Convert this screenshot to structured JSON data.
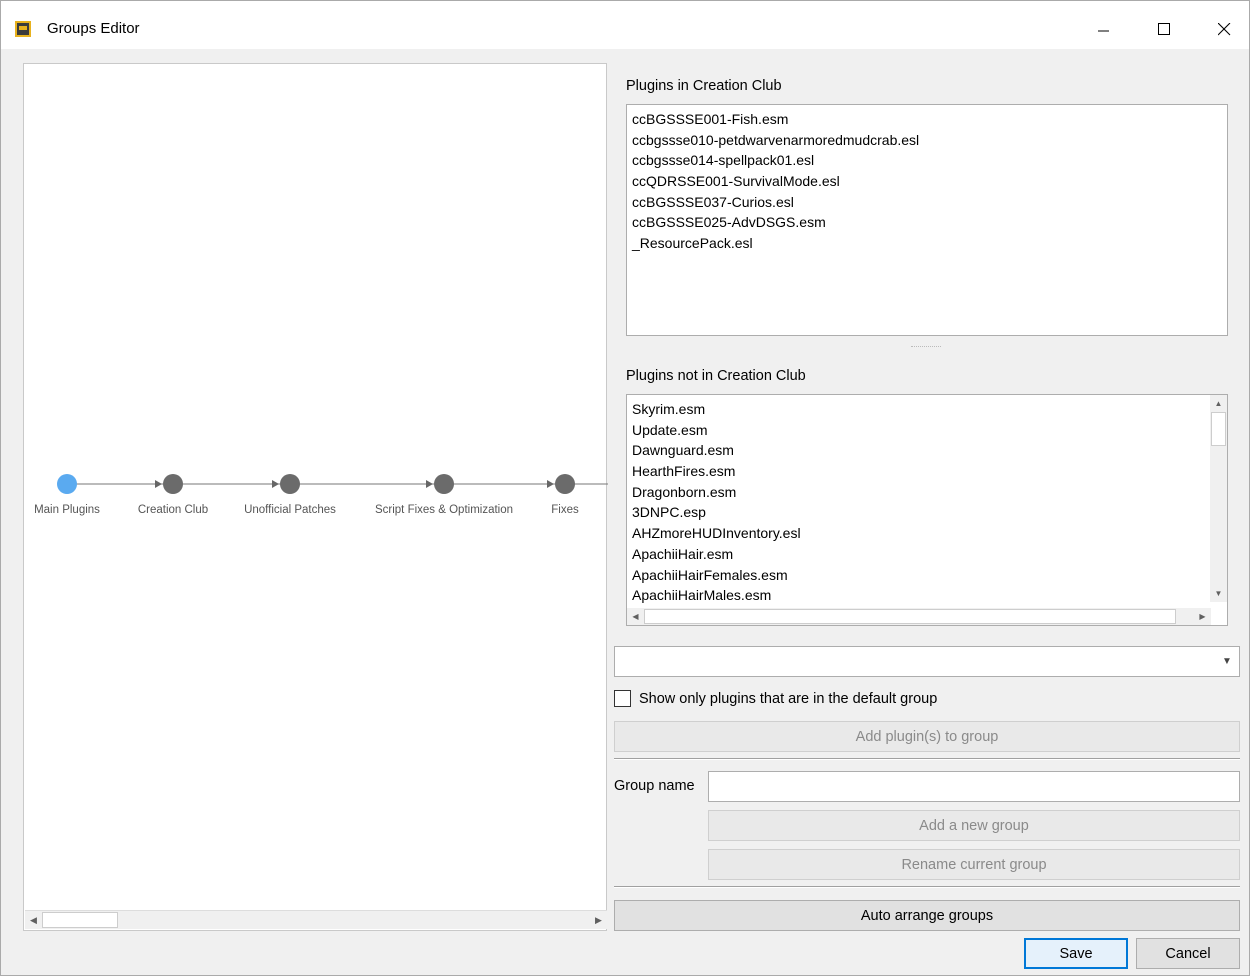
{
  "window": {
    "title": "Groups Editor",
    "minimize_icon": "minimize-icon",
    "maximize_icon": "maximize-icon",
    "close_icon": "close-icon"
  },
  "graph": {
    "nodes": [
      {
        "label": "Main Plugins",
        "color": "#5aaaf0"
      },
      {
        "label": "Creation Club",
        "color": "#6b6b6b"
      },
      {
        "label": "Unofficial Patches",
        "color": "#6b6b6b"
      },
      {
        "label": "Script Fixes & Optimization",
        "color": "#6b6b6b"
      },
      {
        "label": "Fixes",
        "color": "#6b6b6b"
      }
    ]
  },
  "plugins_in_group": {
    "label": "Plugins in Creation Club",
    "items": [
      "ccBGSSSE001-Fish.esm",
      "ccbgssse010-petdwarvenarmoredmudcrab.esl",
      "ccbgssse014-spellpack01.esl",
      "ccQDRSSE001-SurvivalMode.esl",
      "ccBGSSSE037-Curios.esl",
      "ccBGSSSE025-AdvDSGS.esm",
      "_ResourcePack.esl"
    ]
  },
  "plugins_not_in_group": {
    "label": "Plugins not in Creation Club",
    "items": [
      "Skyrim.esm",
      "Update.esm",
      "Dawnguard.esm",
      "HearthFires.esm",
      "Dragonborn.esm",
      "3DNPC.esp",
      "AHZmoreHUDInventory.esl",
      "ApachiiHair.esm",
      "ApachiiHairFemales.esm",
      "ApachiiHairMales.esm"
    ]
  },
  "plugin_combo": {
    "value": ""
  },
  "show_default_only": {
    "label": "Show only plugins that are in the default group",
    "checked": false
  },
  "add_plugins_button": "Add plugin(s) to group",
  "group_name": {
    "label": "Group name",
    "value": ""
  },
  "add_group_button": "Add a new group",
  "rename_group_button": "Rename current group",
  "auto_arrange_button": "Auto arrange groups",
  "save_button": "Save",
  "cancel_button": "Cancel"
}
